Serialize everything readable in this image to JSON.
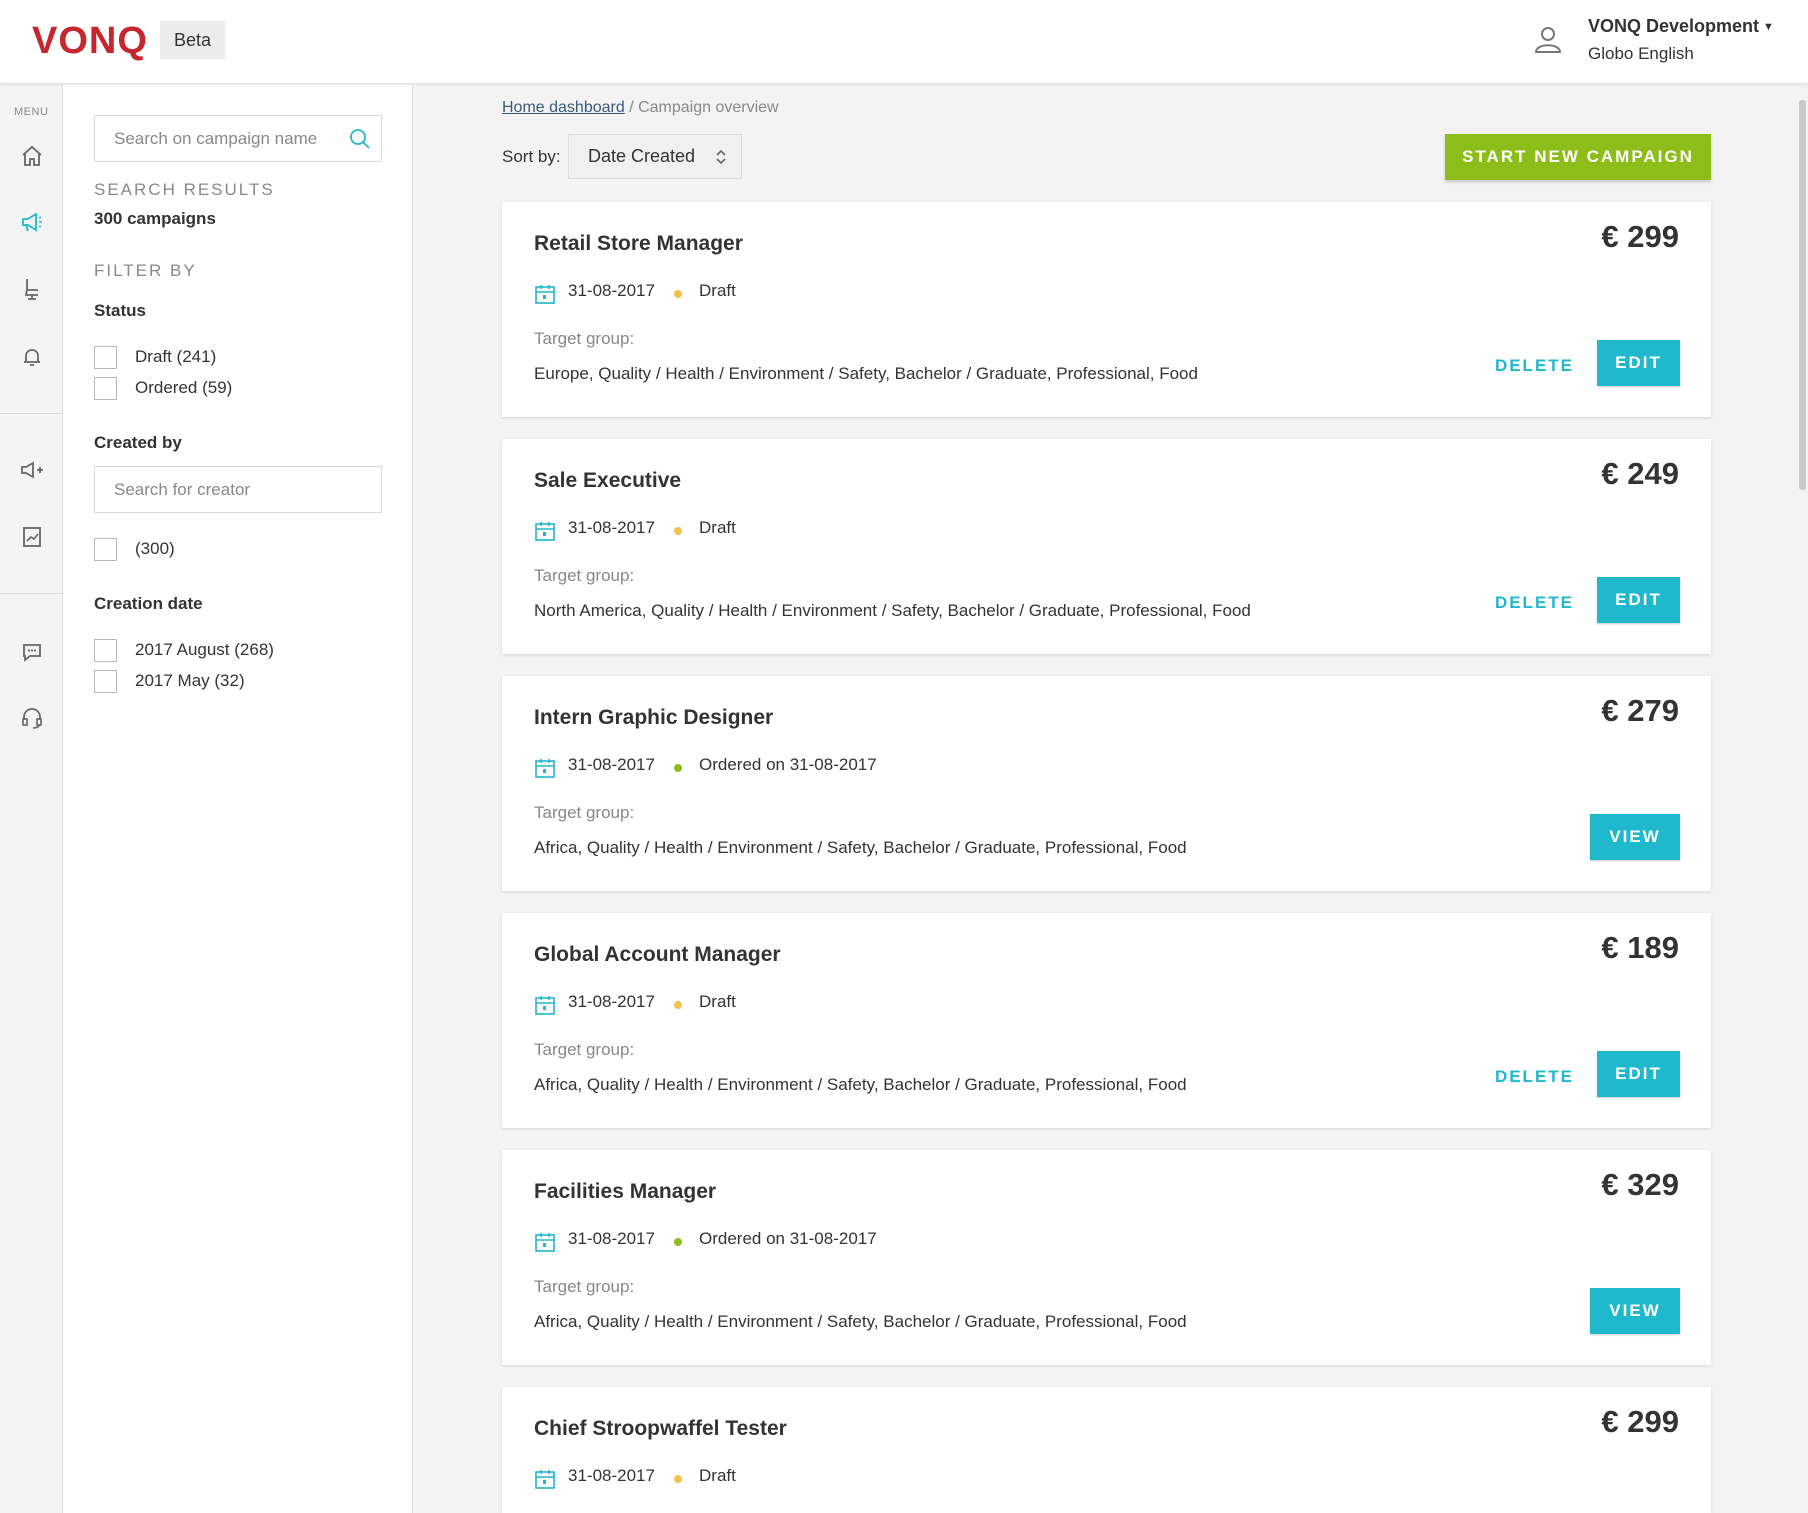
{
  "header": {
    "logo": "VONQ",
    "badge": "Beta",
    "account_name": "VONQ Development",
    "account_lang": "Globo English"
  },
  "rail": {
    "label": "MENU",
    "icons": [
      "home-icon",
      "megaphone-icon",
      "chair-icon",
      "bell-icon",
      "megaphone-plus-icon",
      "document-chart-icon",
      "chat-icon",
      "headset-icon"
    ]
  },
  "filters": {
    "search_placeholder": "Search on campaign name",
    "results_heading": "SEARCH RESULTS",
    "results_count": "300 campaigns",
    "filter_heading": "FILTER BY",
    "status_heading": "Status",
    "status_options": [
      "Draft (241)",
      "Ordered (59)"
    ],
    "created_by_heading": "Created by",
    "creator_placeholder": "Search for creator",
    "creator_options": [
      "(300)"
    ],
    "creation_date_heading": "Creation date",
    "creation_date_options": [
      "2017 August (268)",
      "2017 May (32)"
    ]
  },
  "main": {
    "breadcrumb_home": "Home dashboard",
    "breadcrumb_sep": "/ Campaign overview",
    "sort_label": "Sort by:",
    "sort_value": "Date Created",
    "start_button": "START NEW CAMPAIGN"
  },
  "labels": {
    "target_group": "Target group:",
    "delete": "DELETE",
    "edit": "EDIT",
    "view": "VIEW"
  },
  "colors": {
    "brand_red": "#c8262d",
    "accent_teal": "#1fb8cc",
    "accent_green": "#8cbd18",
    "draft_dot": "#f5c24b",
    "ordered_dot": "#8cbd18"
  },
  "campaigns": [
    {
      "title": "Retail Store Manager",
      "price": "€ 299",
      "date": "31-08-2017",
      "status": "Draft",
      "target": "Europe, Quality / Health / Environment / Safety, Bachelor / Graduate, Professional, Food"
    },
    {
      "title": "Sale Executive",
      "price": "€ 249",
      "date": "31-08-2017",
      "status": "Draft",
      "target": "North America, Quality / Health / Environment / Safety, Bachelor / Graduate, Professional, Food"
    },
    {
      "title": "Intern Graphic Designer",
      "price": "€ 279",
      "date": "31-08-2017",
      "status": "Ordered on 31-08-2017",
      "target": "Africa, Quality / Health / Environment / Safety, Bachelor / Graduate, Professional, Food"
    },
    {
      "title": "Global Account Manager",
      "price": "€ 189",
      "date": "31-08-2017",
      "status": "Draft",
      "target": "Africa, Quality / Health / Environment / Safety, Bachelor / Graduate, Professional, Food"
    },
    {
      "title": "Facilities Manager",
      "price": "€ 329",
      "date": "31-08-2017",
      "status": "Ordered on 31-08-2017",
      "target": "Africa, Quality / Health / Environment / Safety, Bachelor / Graduate, Professional, Food"
    },
    {
      "title": "Chief Stroopwaffel Tester",
      "price": "€ 299",
      "date": "31-08-2017",
      "status": "Draft",
      "target": ""
    }
  ]
}
